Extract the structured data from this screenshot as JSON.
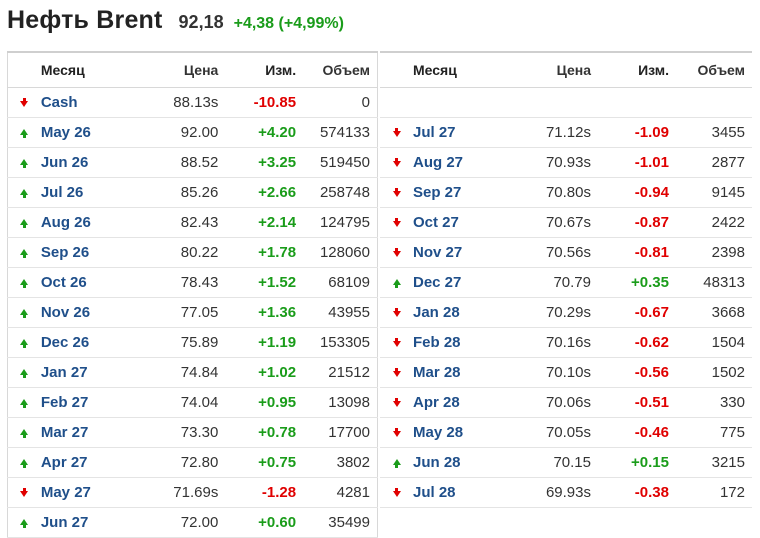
{
  "header": {
    "title": "Нефть Brent",
    "price": "92,18",
    "change": "+4,38 (+4,99%)"
  },
  "columns": {
    "month": "Месяц",
    "price": "Цена",
    "change": "Изм.",
    "volume": "Объем"
  },
  "colors": {
    "up": "#1a9c1a",
    "down": "#e00000",
    "month_link": "#1f4f8a"
  },
  "left_rows": [
    {
      "dir": "down",
      "month": "Cash",
      "price": "88.13s",
      "change": "-10.85",
      "volume": "0"
    },
    {
      "dir": "up",
      "month": "May 26",
      "price": "92.00",
      "change": "+4.20",
      "volume": "574133"
    },
    {
      "dir": "up",
      "month": "Jun 26",
      "price": "88.52",
      "change": "+3.25",
      "volume": "519450"
    },
    {
      "dir": "up",
      "month": "Jul 26",
      "price": "85.26",
      "change": "+2.66",
      "volume": "258748"
    },
    {
      "dir": "up",
      "month": "Aug 26",
      "price": "82.43",
      "change": "+2.14",
      "volume": "124795"
    },
    {
      "dir": "up",
      "month": "Sep 26",
      "price": "80.22",
      "change": "+1.78",
      "volume": "128060"
    },
    {
      "dir": "up",
      "month": "Oct 26",
      "price": "78.43",
      "change": "+1.52",
      "volume": "68109"
    },
    {
      "dir": "up",
      "month": "Nov 26",
      "price": "77.05",
      "change": "+1.36",
      "volume": "43955"
    },
    {
      "dir": "up",
      "month": "Dec 26",
      "price": "75.89",
      "change": "+1.19",
      "volume": "153305"
    },
    {
      "dir": "up",
      "month": "Jan 27",
      "price": "74.84",
      "change": "+1.02",
      "volume": "21512"
    },
    {
      "dir": "up",
      "month": "Feb 27",
      "price": "74.04",
      "change": "+0.95",
      "volume": "13098"
    },
    {
      "dir": "up",
      "month": "Mar 27",
      "price": "73.30",
      "change": "+0.78",
      "volume": "17700"
    },
    {
      "dir": "up",
      "month": "Apr 27",
      "price": "72.80",
      "change": "+0.75",
      "volume": "3802"
    },
    {
      "dir": "down",
      "month": "May 27",
      "price": "71.69s",
      "change": "-1.28",
      "volume": "4281"
    },
    {
      "dir": "up",
      "month": "Jun 27",
      "price": "72.00",
      "change": "+0.60",
      "volume": "35499"
    }
  ],
  "right_rows": [
    {
      "dir": "down",
      "month": "Jul 27",
      "price": "71.12s",
      "change": "-1.09",
      "volume": "3455"
    },
    {
      "dir": "down",
      "month": "Aug 27",
      "price": "70.93s",
      "change": "-1.01",
      "volume": "2877"
    },
    {
      "dir": "down",
      "month": "Sep 27",
      "price": "70.80s",
      "change": "-0.94",
      "volume": "9145"
    },
    {
      "dir": "down",
      "month": "Oct 27",
      "price": "70.67s",
      "change": "-0.87",
      "volume": "2422"
    },
    {
      "dir": "down",
      "month": "Nov 27",
      "price": "70.56s",
      "change": "-0.81",
      "volume": "2398"
    },
    {
      "dir": "up",
      "month": "Dec 27",
      "price": "70.79",
      "change": "+0.35",
      "volume": "48313"
    },
    {
      "dir": "down",
      "month": "Jan 28",
      "price": "70.29s",
      "change": "-0.67",
      "volume": "3668"
    },
    {
      "dir": "down",
      "month": "Feb 28",
      "price": "70.16s",
      "change": "-0.62",
      "volume": "1504"
    },
    {
      "dir": "down",
      "month": "Mar 28",
      "price": "70.10s",
      "change": "-0.56",
      "volume": "1502"
    },
    {
      "dir": "down",
      "month": "Apr 28",
      "price": "70.06s",
      "change": "-0.51",
      "volume": "330"
    },
    {
      "dir": "down",
      "month": "May 28",
      "price": "70.05s",
      "change": "-0.46",
      "volume": "775"
    },
    {
      "dir": "up",
      "month": "Jun 28",
      "price": "70.15",
      "change": "+0.15",
      "volume": "3215"
    },
    {
      "dir": "down",
      "month": "Jul 28",
      "price": "69.93s",
      "change": "-0.38",
      "volume": "172"
    }
  ]
}
